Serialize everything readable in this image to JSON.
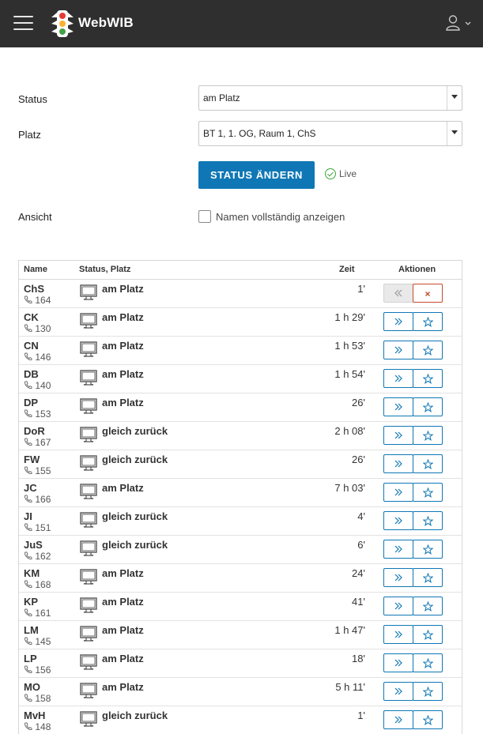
{
  "header": {
    "brand": "WebWIB"
  },
  "form": {
    "status_label": "Status",
    "status_value": "am Platz",
    "place_label": "Platz",
    "place_value": "BT 1, 1. OG, Raum 1, ChS",
    "submit_label": "STATUS ÄNDERN",
    "live_label": "Live",
    "view_label": "Ansicht",
    "fullname_label": "Namen vollständig anzeigen"
  },
  "table": {
    "headers": {
      "name": "Name",
      "status": "Status, Platz",
      "time": "Zeit",
      "actions": "Aktionen"
    },
    "rows": [
      {
        "name": "ChS",
        "ext": "164",
        "status": "am Platz",
        "time": "1'",
        "self": true
      },
      {
        "name": "CK",
        "ext": "130",
        "status": "am Platz",
        "time": "1 h 29'"
      },
      {
        "name": "CN",
        "ext": "146",
        "status": "am Platz",
        "time": "1 h 53'"
      },
      {
        "name": "DB",
        "ext": "140",
        "status": "am Platz",
        "time": "1 h 54'"
      },
      {
        "name": "DP",
        "ext": "153",
        "status": "am Platz",
        "time": "26'"
      },
      {
        "name": "DoR",
        "ext": "167",
        "status": "gleich zurück",
        "time": "2 h 08'"
      },
      {
        "name": "FW",
        "ext": "155",
        "status": "gleich zurück",
        "time": "26'"
      },
      {
        "name": "JC",
        "ext": "166",
        "status": "am Platz",
        "time": "7 h 03'"
      },
      {
        "name": "JI",
        "ext": "151",
        "status": "gleich zurück",
        "time": "4'"
      },
      {
        "name": "JuS",
        "ext": "162",
        "status": "gleich zurück",
        "time": "6'"
      },
      {
        "name": "KM",
        "ext": "168",
        "status": "am Platz",
        "time": "24'"
      },
      {
        "name": "KP",
        "ext": "161",
        "status": "am Platz",
        "time": "41'"
      },
      {
        "name": "LM",
        "ext": "145",
        "status": "am Platz",
        "time": "1 h 47'"
      },
      {
        "name": "LP",
        "ext": "156",
        "status": "am Platz",
        "time": "18'"
      },
      {
        "name": "MO",
        "ext": "158",
        "status": "am Platz",
        "time": "5 h 11'"
      },
      {
        "name": "MvH",
        "ext": "148",
        "status": "gleich zurück",
        "time": "1'"
      }
    ]
  },
  "icons": {
    "menu": "hamburger-menu-icon",
    "logo": "traffic-light-logo-icon",
    "user": "user-icon",
    "phone": "phone-icon",
    "monitor": "monitor-icon",
    "forward": "double-chevron-right-icon",
    "back": "double-chevron-left-icon",
    "star": "star-icon",
    "close": "close-icon",
    "check": "check-circle-icon"
  },
  "colors": {
    "topbar": "#2f2f2f",
    "primary": "#0f77b5",
    "danger": "#c44a2a",
    "live": "#3ba83b"
  }
}
